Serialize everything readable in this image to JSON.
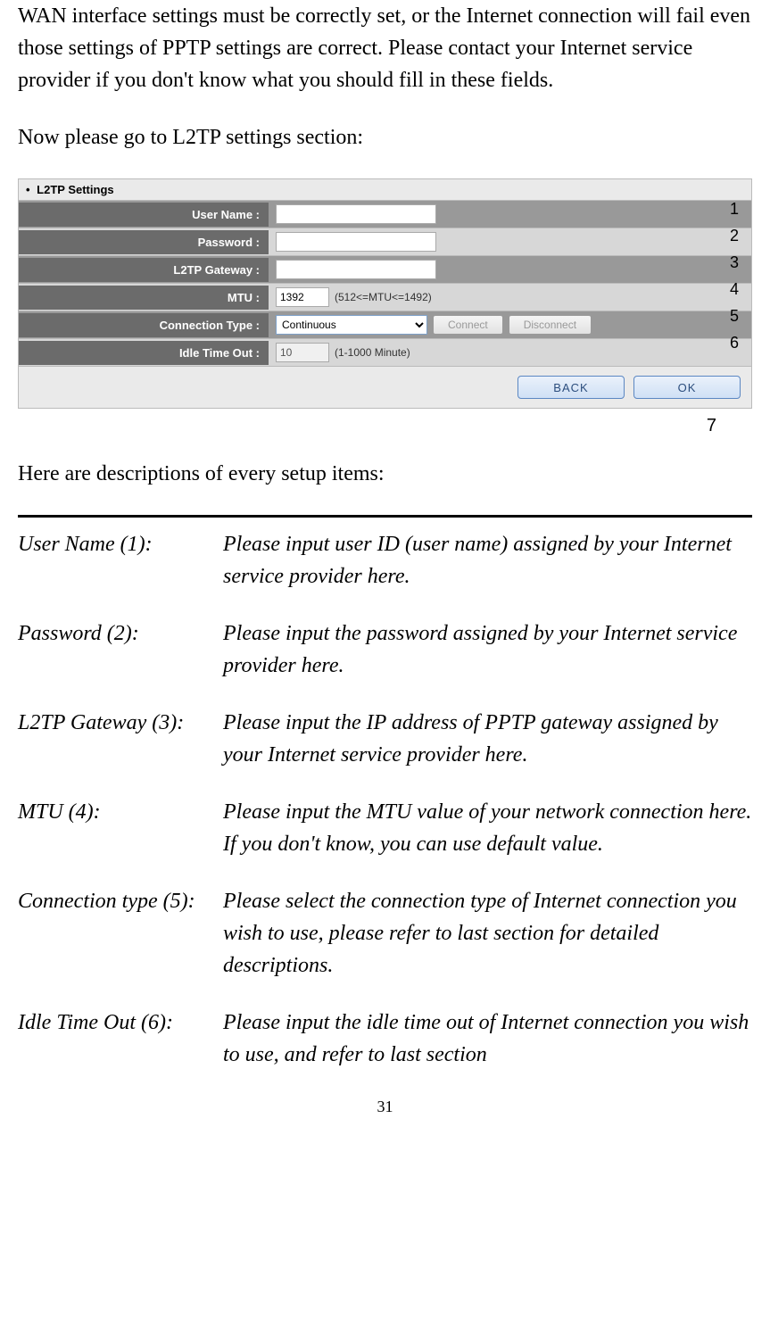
{
  "intro1": "WAN interface settings must be correctly set, or the Internet connection will fail even those settings of PPTP settings are correct. Please contact your Internet service provider if you don't know what you should fill in these fields.",
  "intro2": "Now please go to L2TP settings section:",
  "panel": {
    "header": "L2TP Settings",
    "rows": {
      "username": {
        "label": "User Name :",
        "value": ""
      },
      "password": {
        "label": "Password :",
        "value": ""
      },
      "gateway": {
        "label": "L2TP Gateway :",
        "value": ""
      },
      "mtu": {
        "label": "MTU :",
        "value": "1392",
        "hint": "(512<=MTU<=1492)"
      },
      "conn": {
        "label": "Connection Type :",
        "value": "Continuous",
        "connect": "Connect",
        "disconnect": "Disconnect"
      },
      "idle": {
        "label": "Idle Time Out :",
        "value": "10",
        "hint": "(1-1000 Minute)"
      }
    },
    "back": "BACK",
    "ok": "OK"
  },
  "annotations": {
    "a1": "1",
    "a2": "2",
    "a3": "3",
    "a4": "4",
    "a5": "5",
    "a6": "6",
    "a7": "7"
  },
  "desc_intro": "Here are descriptions of every setup items:",
  "descriptions": {
    "username": {
      "label": "User Name (1):",
      "text": "Please input user ID (user name) assigned by your Internet service provider here."
    },
    "password": {
      "label": "Password (2):",
      "text": "Please input the password assigned by your Internet service provider here."
    },
    "gateway": {
      "label": "L2TP Gateway (3):",
      "text": "Please input the IP address of PPTP gateway assigned by your Internet service provider here."
    },
    "mtu": {
      "label": "MTU (4):",
      "text": "Please input the MTU value of your network connection here. If you don't know, you can use default value."
    },
    "conn": {
      "label": "Connection type (5):",
      "text": "Please select the connection type of Internet connection you wish to use, please refer to last section for detailed descriptions."
    },
    "idle": {
      "label": "Idle Time Out (6):",
      "text": "Please input the idle time out of Internet connection you wish to use, and refer to last section"
    }
  },
  "page_number": "31"
}
